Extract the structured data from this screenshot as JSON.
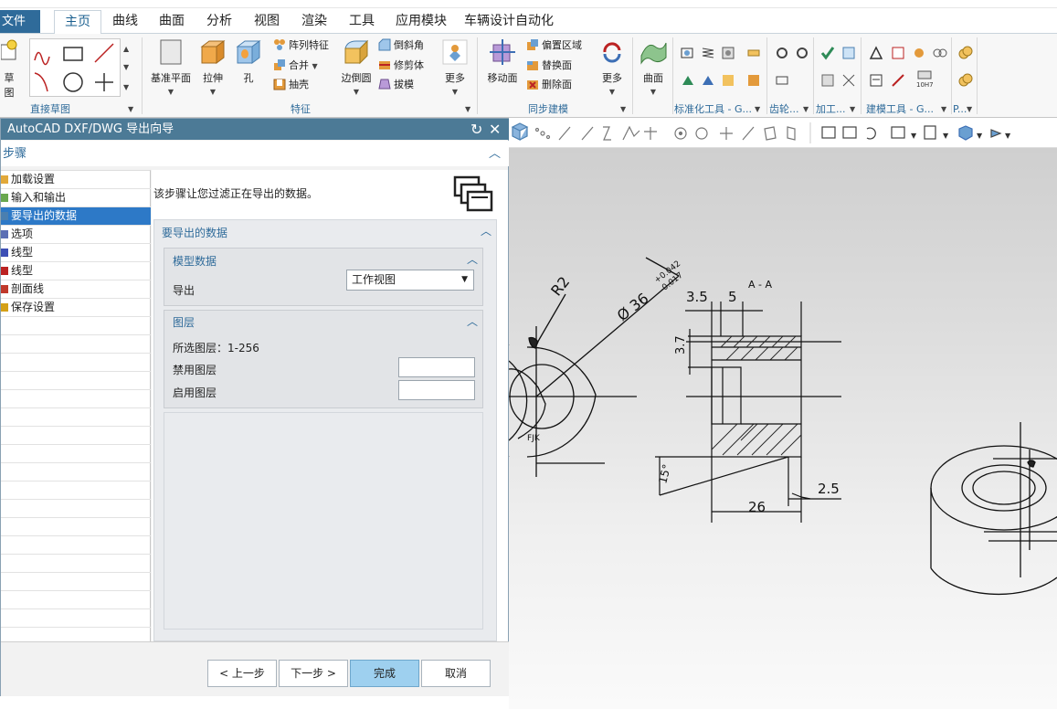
{
  "menu": {
    "file": "文件(F)",
    "tabs": [
      "主页",
      "曲线",
      "曲面",
      "分析",
      "视图",
      "渲染",
      "工具",
      "应用模块",
      "车辆设计自动化"
    ],
    "active": "主页"
  },
  "ribbon": {
    "groups": {
      "sketch": "直接草图",
      "feature": "特征",
      "sync": "同步建模",
      "std": "标准化工具 - G...",
      "gear": "齿轮...",
      "process": "加工...",
      "modeling": "建模工具 - G...",
      "p": "P..."
    },
    "sketch_label": "草图",
    "datum_plane": "基准平面",
    "extrude": "拉伸",
    "hole": "孔",
    "pattern": "阵列特征",
    "unite": "合并",
    "shell": "抽壳",
    "edge_blend": "边倒圆",
    "chamfer": "倒斜角",
    "trim_body": "修剪体",
    "draft": "拔模",
    "more1": "更多",
    "move_face": "移动面",
    "offset_region": "偏置区域",
    "replace_face": "替换面",
    "delete_face": "删除面",
    "more2": "更多",
    "surface": "曲面",
    "h7": "10H7"
  },
  "dialog": {
    "title": "AutoCAD DXF/DWG 导出向导",
    "steps_header": "步骤",
    "steps": [
      "加载设置",
      "输入和输出",
      "要导出的数据",
      "选项",
      "线型",
      "线型",
      "剖面线",
      "保存设置"
    ],
    "selected_step": 2,
    "description": "该步骤让您过滤正在导出的数据。",
    "section_title": "要导出的数据",
    "model_data": {
      "title": "模型数据",
      "export_label": "导出",
      "export_value": "工作视图"
    },
    "layers": {
      "title": "图层",
      "selected_layers": "所选图层：1-256",
      "disabled_label": "禁用图层",
      "enabled_label": "启用图层"
    },
    "buttons": {
      "back": "< 上一步",
      "next": "下一步 >",
      "finish": "完成",
      "cancel": "取消"
    }
  },
  "drawing": {
    "r2": "R2",
    "dia": "Ø 36",
    "tol_upper": "+0.042",
    "tol_lower": "-0.017",
    "section": "A - A",
    "d35": "3.5",
    "d5": "5",
    "d37": "3.7",
    "angle": "15°",
    "d25": "2.5",
    "d26": "26",
    "fk": "FJK"
  },
  "colors": {
    "accent": "#2f6b9a",
    "dialog_title": "#4c7a96",
    "selected_row": "#2d79c7",
    "finish_button": "#9ed0ef"
  }
}
